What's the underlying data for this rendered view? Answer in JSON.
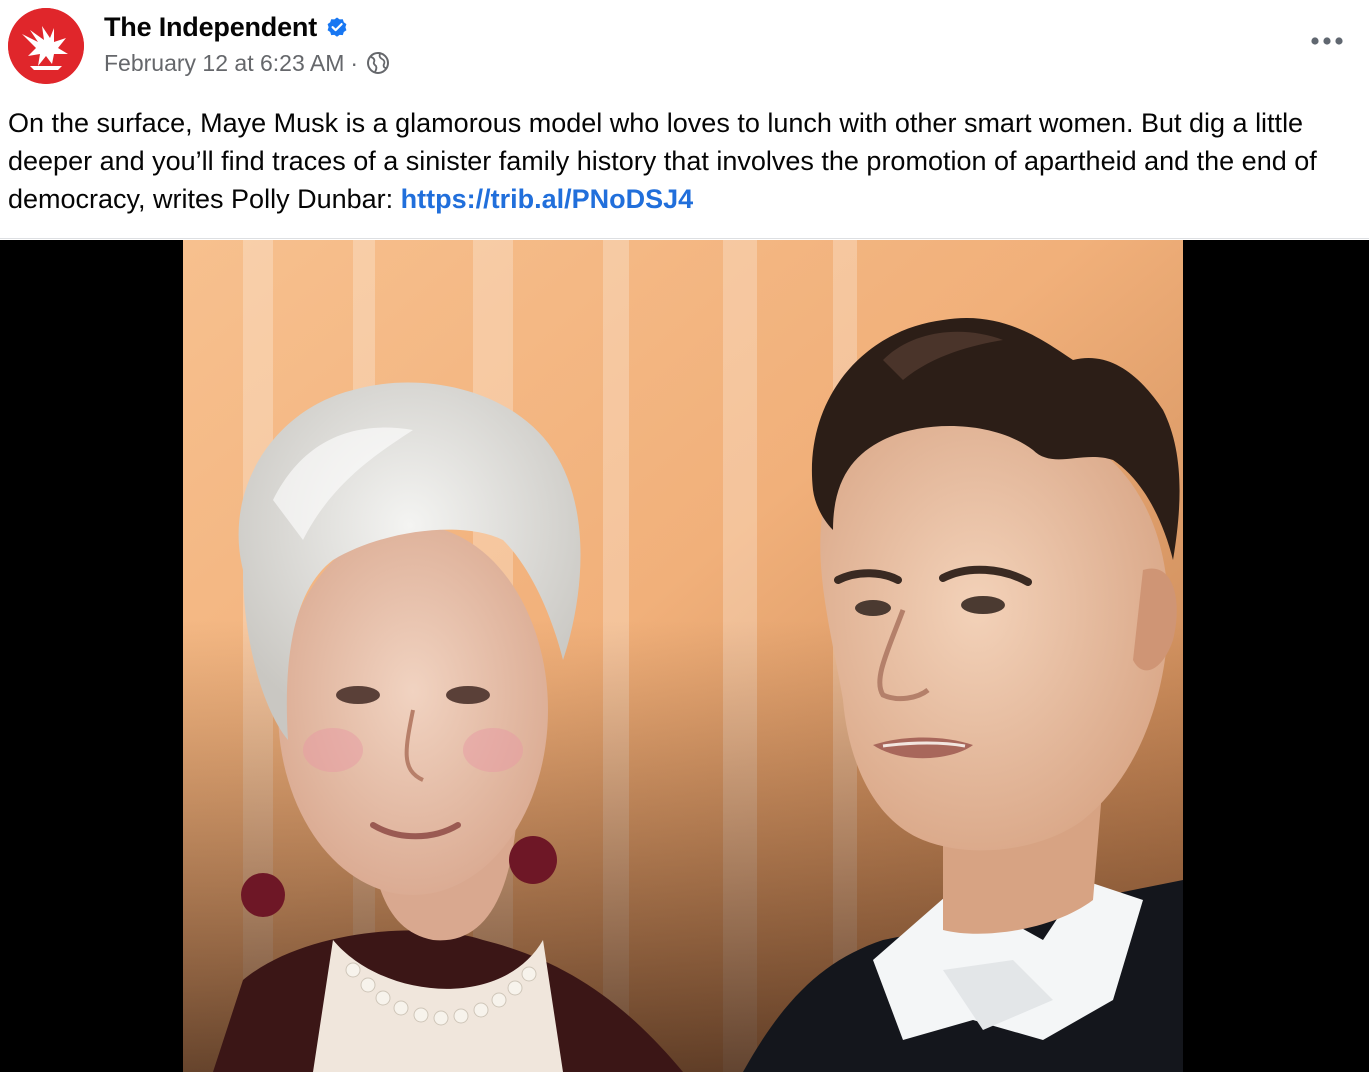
{
  "post": {
    "page_name": "The Independent",
    "timestamp": "February 12 at 6:23 AM",
    "separator": "·",
    "audience_icon": "globe-icon",
    "verified_icon": "verified-badge-icon",
    "more_icon": "more-options-icon",
    "text": "On the surface, Maye Musk is a glamorous model who loves to lunch with other smart women. But dig a little deeper and you’ll find traces of a sinister family history that involves the promotion of apartheid and the end of democracy, writes Polly Dunbar: ",
    "link": "https://trib.al/PNoDSJ4"
  },
  "colors": {
    "avatar_bg": "#e0262b",
    "verified": "#1877f2",
    "link": "#216fdb",
    "meta_text": "#65676b",
    "media_letterbox": "#000000"
  },
  "media": {
    "type": "photo",
    "subject": "photo of an older woman with white hair and a man in a white tie and black jacket"
  }
}
